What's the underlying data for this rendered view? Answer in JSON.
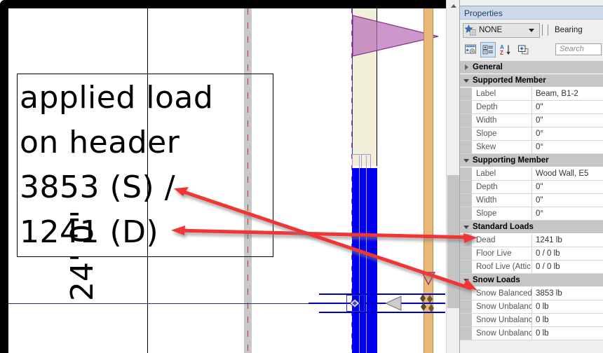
{
  "annotation": {
    "callout_lines": "applied load\non header\n3853 (S) /\n1241 (D)",
    "dimension_label": "24' 0\"",
    "arrow_color": "#f03434"
  },
  "properties_panel": {
    "title": "Properties",
    "type_selector": {
      "value": "NONE",
      "icon": "star-type-icon",
      "caret": "chevron-down-icon"
    },
    "category_label": "Bearing",
    "toolbar": [
      {
        "name": "edit-type-icon",
        "label": "Edit Type"
      },
      {
        "name": "categorized-list-icon",
        "label": "Categorized"
      },
      {
        "name": "sort-az-icon",
        "label": "Sort A-Z"
      },
      {
        "name": "new-instance-icon",
        "label": "New"
      }
    ],
    "search": {
      "placeholder": "Search",
      "value": ""
    },
    "groups": [
      {
        "label": "General",
        "expanded": false,
        "rows": []
      },
      {
        "label": "Supported Member",
        "expanded": true,
        "rows": [
          {
            "name": "Label",
            "value": "Beam, B1-2"
          },
          {
            "name": "Depth",
            "value": "0\""
          },
          {
            "name": "Width",
            "value": "0\""
          },
          {
            "name": "Slope",
            "value": "0°"
          },
          {
            "name": "Skew",
            "value": "0°"
          }
        ]
      },
      {
        "label": "Supporting Member",
        "expanded": true,
        "rows": [
          {
            "name": "Label",
            "value": "Wood Wall, E5"
          },
          {
            "name": "Depth",
            "value": "0\""
          },
          {
            "name": "Width",
            "value": "0\""
          },
          {
            "name": "Slope",
            "value": "0°"
          }
        ]
      },
      {
        "label": "Standard Loads",
        "expanded": true,
        "rows": [
          {
            "name": "Dead",
            "value": "1241 lb"
          },
          {
            "name": "Floor Live",
            "value": "0 / 0 lb"
          },
          {
            "name": "Roof Live (Attic",
            "value": "0 / 0 lb"
          }
        ]
      },
      {
        "label": "Snow Loads",
        "expanded": true,
        "rows": [
          {
            "name": "Snow Balanced",
            "value": "3853 lb"
          },
          {
            "name": "Snow Unbalanc",
            "value": "0 lb"
          },
          {
            "name": "Snow Unbalanc",
            "value": "0 lb"
          },
          {
            "name": "Snow Unbalanc",
            "value": "0 lb"
          }
        ]
      }
    ]
  },
  "colors": {
    "beam_blue": "#0000f0",
    "column_orange": "#e8b87a",
    "wall_cream": "#f2f0d8",
    "load_purple": "#b870b8",
    "wall_gray": "#c8c8c8",
    "centerline_red": "#b03a34",
    "annotation_red": "#f03434"
  }
}
